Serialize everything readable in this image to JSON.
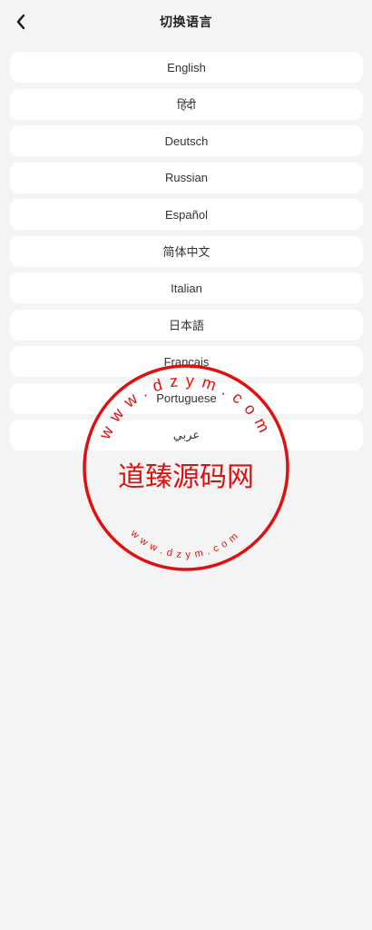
{
  "header": {
    "title": "切换语言",
    "back_icon": "chevron-left-icon"
  },
  "languages": [
    {
      "label": "English"
    },
    {
      "label": "हिंदी"
    },
    {
      "label": "Deutsch"
    },
    {
      "label": "Russian"
    },
    {
      "label": "Español"
    },
    {
      "label": "简体中文"
    },
    {
      "label": "Italian"
    },
    {
      "label": "日本語"
    },
    {
      "label": "Français"
    },
    {
      "label": "Portuguese"
    },
    {
      "label": "عربي"
    }
  ],
  "watermark": {
    "text": "道臻源码网",
    "url_top": "www.dzym.com",
    "url_bottom": "www.dzym.com",
    "color": "#e01010"
  }
}
